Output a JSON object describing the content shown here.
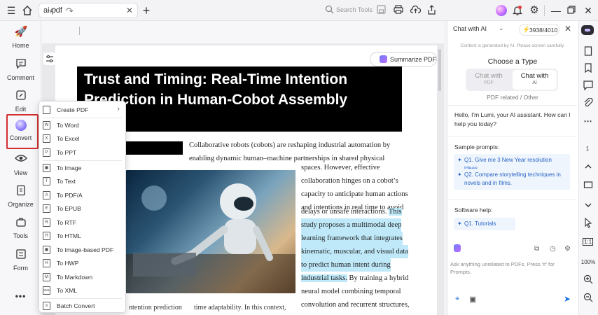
{
  "titlebar": {
    "tab_name": "ai.pdf",
    "icons": [
      "hamburger-icon",
      "home-icon",
      "close-tab-icon",
      "add-tab-icon",
      "avatar-icon",
      "bell-icon",
      "gear-icon",
      "minimize-icon",
      "restore-icon",
      "close-window-icon"
    ]
  },
  "sidebar": {
    "items": [
      {
        "label": "Home",
        "icon": "rocket-icon"
      },
      {
        "label": "Comment",
        "icon": "comment-icon"
      },
      {
        "label": "Edit",
        "icon": "edit-icon"
      },
      {
        "label": "Convert",
        "icon": "convert-icon"
      },
      {
        "label": "View",
        "icon": "eye-icon"
      },
      {
        "label": "Organize",
        "icon": "organize-icon"
      },
      {
        "label": "Tools",
        "icon": "tools-icon"
      },
      {
        "label": "Form",
        "icon": "form-icon"
      }
    ],
    "more": "•••"
  },
  "toolbar": {
    "search_label": "Search Tools"
  },
  "document": {
    "summarize_label": "Summarize PDF",
    "title_line1": "Trust and Timing: Real-Time Intention",
    "title_line2": "Prediction in Human-Cobot Assembly",
    "intro_line1": "Collaborative robots (cobots) are reshaping industrial automation by",
    "intro_line2": "enabling dynamic human–machine partnerships in shared physical",
    "col_lines": [
      "spaces. However, effective",
      "collaboration hinges on a cobot’s",
      "capacity to anticipate human actions",
      "and intentions in real time to avoid"
    ],
    "line_delays_plain": "delays or unsafe interactions. ",
    "line_delays_hl": "This",
    "hl_lines": [
      "study proposes a multimodal deep",
      "learning framework that integrates",
      "kinematic, muscular, and visual data",
      "to predict human intent during"
    ],
    "line_industrial_hl": "industrial tasks.",
    "line_industrial_plain": " By training a hybrid",
    "tail_lines": [
      "neural model combining temporal",
      "convolution and recurrent structures,"
    ],
    "foot_left": "ntention prediction",
    "foot_mid": "time adaptability. In this context,",
    "foot_right": "recognition systems typically rely"
  },
  "convert_menu": {
    "items": [
      {
        "label": "Create PDF",
        "icon": "create-pdf-icon",
        "glyph": "",
        "submenu": true
      },
      {
        "label": "To Word",
        "icon": "word-icon",
        "glyph": "W"
      },
      {
        "label": "To Excel",
        "icon": "excel-icon",
        "glyph": "X"
      },
      {
        "label": "To PPT",
        "icon": "ppt-icon",
        "glyph": "P"
      },
      {
        "label": "To Image",
        "icon": "image-icon",
        "glyph": "▣"
      },
      {
        "label": "To Text",
        "icon": "text-icon",
        "glyph": "T"
      },
      {
        "label": "To PDF/A",
        "icon": "pdfa-icon",
        "glyph": "A"
      },
      {
        "label": "To EPUB",
        "icon": "epub-icon",
        "glyph": "E"
      },
      {
        "label": "To RTF",
        "icon": "rtf-icon",
        "glyph": "R"
      },
      {
        "label": "To HTML",
        "icon": "html-icon",
        "glyph": "H"
      },
      {
        "label": "To Image-based PDF",
        "icon": "image-pdf-icon",
        "glyph": "▣"
      },
      {
        "label": "To HWP",
        "icon": "hwp-icon",
        "glyph": "H"
      },
      {
        "label": "To Markdown",
        "icon": "markdown-icon",
        "glyph": "M"
      },
      {
        "label": "To XML",
        "icon": "xml-icon",
        "glyph": "XML"
      },
      {
        "label": "Batch Convert",
        "icon": "batch-convert-icon",
        "glyph": "≡"
      }
    ]
  },
  "ai_panel": {
    "chat_mode": "Chat with AI",
    "credits": "3938/4010",
    "note": "Content is generated by AI. Please screen carefully.",
    "choose_type": "Choose a Type",
    "seg_left": "Chat with",
    "seg_left_sub": "PDF",
    "seg_right": "Chat with",
    "seg_right_sub": "AI",
    "pdf_related": "PDF related / Other",
    "greeting": "Hello, I'm Lumi, your AI assistant. How can I help you today?",
    "sample_header": "Sample prompts:",
    "prompts": [
      "Q1. Give me 3 New Year resolution ideas.",
      "Q2. Compare storytelling techniques in novels and in films."
    ],
    "software_header": "Software help:",
    "software_items": [
      "Q1. Tutorials"
    ],
    "ask_placeholder": "Ask anything unrelated to PDFs. Press '#' for Prompts."
  },
  "right_strip": {
    "page": "1",
    "zoom": "100%",
    "fit": "1:1"
  }
}
